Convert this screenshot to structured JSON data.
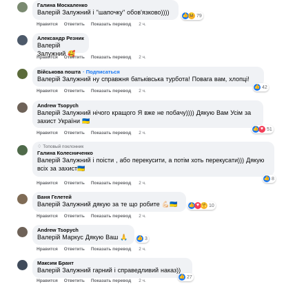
{
  "actions": {
    "like": "Нравится",
    "reply": "Ответить",
    "translate": "Показать перевод"
  },
  "comments": [
    {
      "author": "Галина Москаленко",
      "mention": "Валерій Залужний",
      "text": " і \"шапочку\" обов'язково))))",
      "time": "2 ч.",
      "reactions": {
        "icons": [
          "like-icon",
          "laugh-icon"
        ],
        "count": "79"
      }
    },
    {
      "author": "Александр Резник",
      "mention": "Валерій Залужний",
      "text": " 🥰",
      "time": "2 ч."
    },
    {
      "author": "Військова пошта",
      "subscribe": "· Подписаться",
      "mention": "Валерій Залужний",
      "text": " ну справжня батьківська турбота! Повага вам, хлопці!",
      "time": "2 ч.",
      "reactions": {
        "icons": [
          "like-icon"
        ],
        "count": "42"
      }
    },
    {
      "author": "Andrew Tsopych",
      "mention": "Валерій Залужний",
      "text": " нічого кращого Я вже не побачу)))) Дякую Вам Усім за захист України 🇺🇦",
      "time": "2 ч.",
      "reactions": {
        "icons": [
          "like-icon",
          "love-icon"
        ],
        "count": "51"
      }
    },
    {
      "badge": "Топовый поклонник",
      "author": "Галина Колесниченко",
      "mention": "Валерій Залужний",
      "text": " і поісти , або перекусити, а потім хоть перекусати))) Дякую всіх за захист🇺🇦",
      "time": "2 ч.",
      "reactions": {
        "icons": [
          "like-icon"
        ],
        "count": "8"
      }
    },
    {
      "author": "Ваня Гелетей",
      "mention": "Валерій Залужний",
      "text": " дякую за те що робите 💪🏻🇺🇦",
      "time": "2 ч.",
      "reactions": {
        "icons": [
          "like-icon",
          "love-icon",
          "care-icon"
        ],
        "count": "10"
      }
    },
    {
      "author": "Andrew Tsopych",
      "mention": "Валерій Маркус",
      "text": " Дякую Ваш 🙏",
      "time": "2 ч.",
      "reactions": {
        "icons": [
          "like-icon"
        ],
        "count": "3"
      }
    },
    {
      "author": "Максим Брант",
      "mention": "Валерій Залужний",
      "text": " гарний і справедливий наказ))",
      "time": "2 ч.",
      "reactions": {
        "icons": [
          "like-icon"
        ],
        "count": "27"
      }
    }
  ]
}
